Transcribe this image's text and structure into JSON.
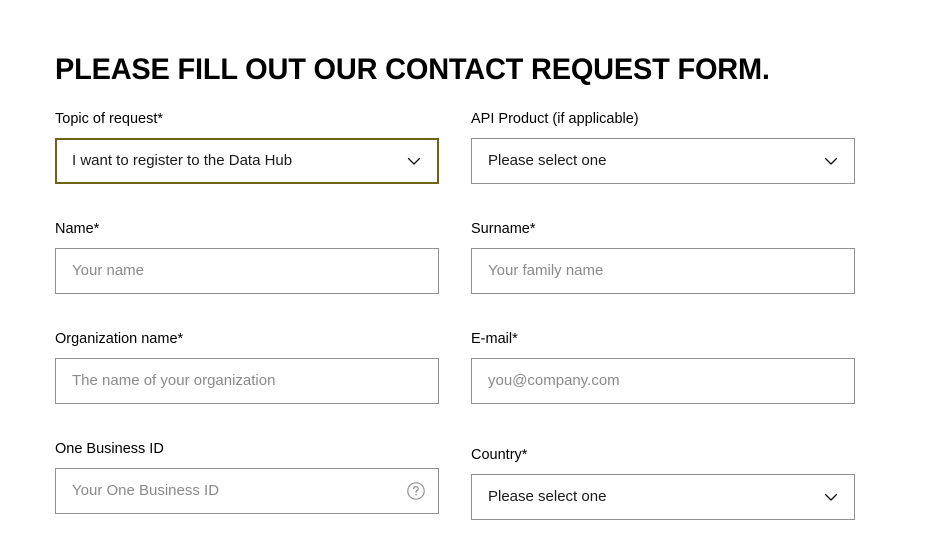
{
  "page": {
    "title": "PLEASE FILL OUT OUR CONTACT REQUEST FORM.",
    "background_color": "#ffffff",
    "text_color": "#000000",
    "border_color": "#8f8f8f",
    "focus_border_color": "#6b6415",
    "placeholder_color": "#8a8a8a"
  },
  "form": {
    "fields": [
      {
        "name": "topic-of-request",
        "label": "Topic of request*",
        "type": "select",
        "value": "I want to register to the Data Hub",
        "focused": true,
        "icon": "chevron-down-icon"
      },
      {
        "name": "api-product",
        "label": "API Product (if applicable)",
        "type": "select",
        "value": "Please select one",
        "focused": false,
        "icon": "chevron-down-icon"
      },
      {
        "name": "name",
        "label": "Name*",
        "type": "text",
        "value": "",
        "placeholder": "Your name",
        "focused": false
      },
      {
        "name": "surname",
        "label": "Surname*",
        "type": "text",
        "value": "",
        "placeholder": "Your family name",
        "focused": false
      },
      {
        "name": "organization-name",
        "label": "Organization name*",
        "type": "text",
        "value": "",
        "placeholder": "The name of your organization",
        "focused": false
      },
      {
        "name": "email",
        "label": "E-mail*",
        "type": "email",
        "value": "",
        "placeholder": "you@company.com",
        "focused": false
      },
      {
        "name": "one-business-id",
        "label": "One Business ID",
        "type": "text",
        "value": "",
        "placeholder": "Your One Business ID",
        "focused": false,
        "icon": "help-circle-icon"
      },
      {
        "name": "country",
        "label": "Country*",
        "type": "select",
        "value": "Please select one",
        "focused": false,
        "icon": "chevron-down-icon"
      }
    ]
  }
}
